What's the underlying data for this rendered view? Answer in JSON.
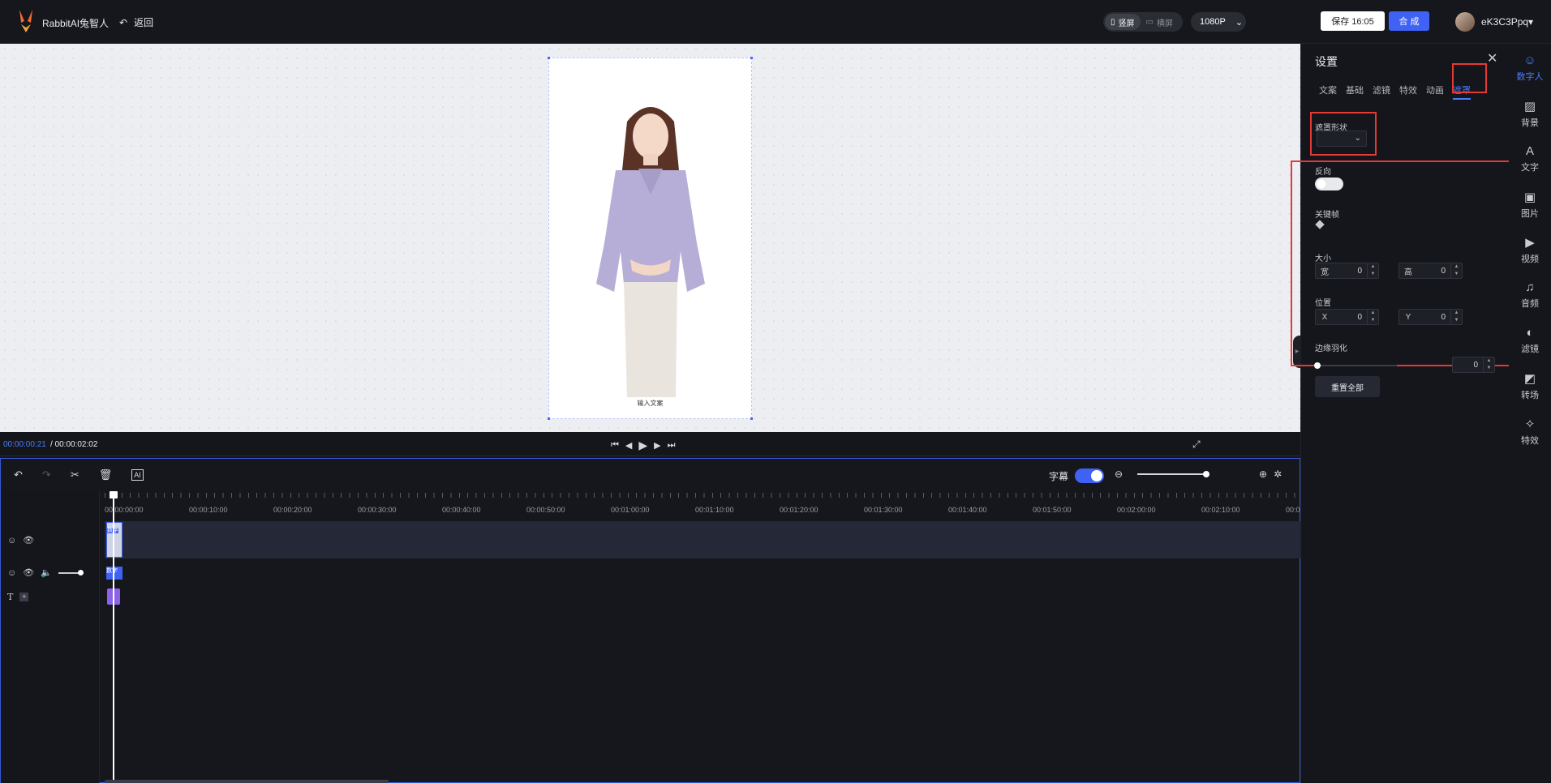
{
  "header": {
    "brand": "RabbitAI兔智人",
    "back_label": "返回",
    "portrait_label": "竖屏",
    "landscape_label": "横屏",
    "resolution": "1080P",
    "save_label": "保存 16:05",
    "compose_label": "合 成",
    "username": "eK3C3Ppq"
  },
  "canvas": {
    "caption": "输入文案"
  },
  "playback": {
    "current_time": "00:00:00:21",
    "separator": "/",
    "total_time": "00:00:02:02"
  },
  "timeline": {
    "subtitle_label": "字幕",
    "subtitle_enabled": true,
    "ruler_labels": [
      "00:00:00:00",
      "00:00:10:00",
      "00:00:20:00",
      "00:00:30:00",
      "00:00:40:00",
      "00:00:50:00",
      "00:01:00:00",
      "00:01:10:00",
      "00:01:20:00",
      "00:01:30:00",
      "00:01:40:00",
      "00:01:50:00",
      "00:02:00:00",
      "00:02:10:00",
      "00:0"
    ],
    "clip1_label": "数字",
    "clip2_label": "数字"
  },
  "settings": {
    "title": "设置",
    "tabs": [
      "文案",
      "基础",
      "滤镜",
      "特效",
      "动画",
      "遮罩"
    ],
    "active_tab": "遮罩",
    "mask_shape_label": "遮罩形状",
    "invert_label": "反向",
    "keyframe_label": "关键帧",
    "size_label": "大小",
    "width_key": "宽",
    "width_value": "0",
    "height_key": "高",
    "height_value": "0",
    "position_label": "位置",
    "x_key": "X",
    "x_value": "0",
    "y_key": "Y",
    "y_value": "0",
    "feather_label": "边缘羽化",
    "feather_value": "0",
    "reset_label": "重置全部"
  },
  "rail": [
    {
      "label": "数字人",
      "icon": "digital-human-icon",
      "active": true
    },
    {
      "label": "背景",
      "icon": "background-icon"
    },
    {
      "label": "文字",
      "icon": "text-icon"
    },
    {
      "label": "图片",
      "icon": "image-icon"
    },
    {
      "label": "视频",
      "icon": "video-icon"
    },
    {
      "label": "音频",
      "icon": "audio-icon"
    },
    {
      "label": "滤镜",
      "icon": "filter-icon"
    },
    {
      "label": "转场",
      "icon": "transition-icon"
    },
    {
      "label": "特效",
      "icon": "effects-icon"
    }
  ],
  "colors": {
    "accent": "#3f62f5",
    "highlight": "#e53935",
    "bg": "#15161b"
  }
}
